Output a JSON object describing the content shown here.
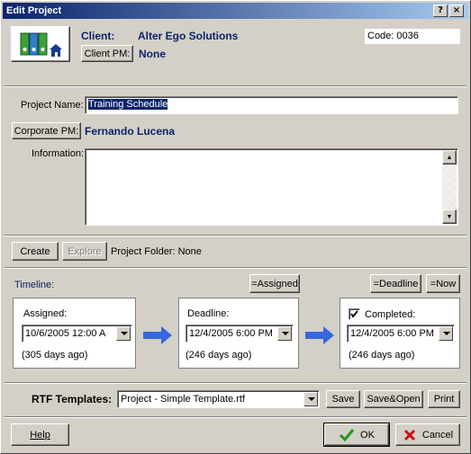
{
  "window": {
    "title": "Edit Project",
    "help_btn": "?",
    "close_btn": "×"
  },
  "client": {
    "label": "Client:",
    "name": "Alter Ego Solutions",
    "pm_button": "Client PM:",
    "pm_value": "None",
    "code_label": "Code:",
    "code_value": "0036"
  },
  "project": {
    "name_label": "Project Name:",
    "name_value": "Training Schedule",
    "corporate_pm_button": "Corporate PM:",
    "corporate_pm_value": "Fernando Lucena",
    "information_label": "Information:",
    "information_value": ""
  },
  "folder": {
    "create_button": "Create",
    "explore_button": "Explore",
    "folder_text": "Project Folder: None"
  },
  "timeline": {
    "label": "Timeline:",
    "assigned_button": "=Assigned",
    "deadline_button": "=Deadline",
    "now_button": "=Now",
    "assigned": {
      "label": "Assigned:",
      "value": "10/6/2005 12:00 A",
      "ago": "(305 days ago)"
    },
    "deadline": {
      "label": "Deadline:",
      "value": "12/4/2005 6:00 PM",
      "ago": "(246 days ago)"
    },
    "completed": {
      "label": "Completed:",
      "checked": true,
      "value": "12/4/2005 6:00 PM",
      "ago": "(246 days ago)"
    }
  },
  "rtf": {
    "label": "RTF Templates:",
    "selected": "Project - Simple Template.rtf",
    "save_button": "Save",
    "save_open_button": "Save&Open",
    "print_button": "Print"
  },
  "footer": {
    "help_button": "Help",
    "ok_button": "OK",
    "cancel_button": "Cancel"
  },
  "colors": {
    "accent": "#0a246a",
    "arrow": "#3a66dc",
    "ok_check": "#1a9a1a",
    "cancel_x": "#cc1010"
  }
}
